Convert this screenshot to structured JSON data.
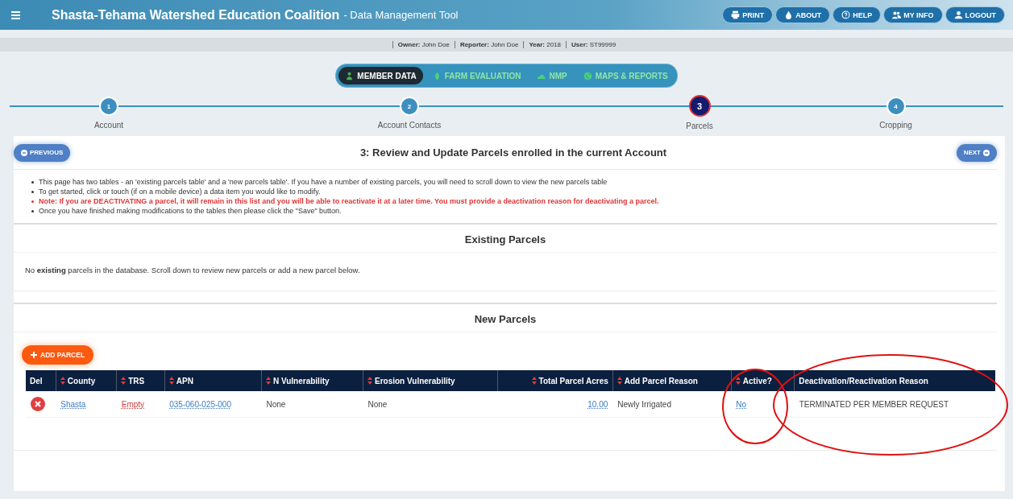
{
  "header": {
    "title": "Shasta-Tehama Watershed Education Coalition",
    "subtitle": "- Data Management Tool",
    "buttons": [
      {
        "label": "PRINT",
        "kind": "print"
      },
      {
        "label": "ABOUT",
        "kind": "about"
      },
      {
        "label": "HELP",
        "kind": "help"
      },
      {
        "label": "MY INFO",
        "kind": "users"
      },
      {
        "label": "LOGOUT",
        "kind": "user"
      }
    ]
  },
  "info_bar": [
    {
      "label": "Owner:",
      "value": "John Doe"
    },
    {
      "label": "Reporter:",
      "value": "John Doe"
    },
    {
      "label": "Year:",
      "value": "2018"
    },
    {
      "label": "User:",
      "value": "ST99999"
    }
  ],
  "modules": [
    {
      "label": "MEMBER DATA",
      "kind": "person",
      "selected": true
    },
    {
      "label": "FARM EVALUATION",
      "kind": "leaf",
      "selected": false
    },
    {
      "label": "NMP",
      "kind": "cloud",
      "selected": false
    },
    {
      "label": "MAPS & REPORTS",
      "kind": "globe",
      "selected": false
    }
  ],
  "steps": [
    {
      "number": "1",
      "label": "Account",
      "selected": false
    },
    {
      "number": "2",
      "label": "Account Contacts",
      "selected": false
    },
    {
      "number": "3",
      "label": "Parcels",
      "selected": true
    },
    {
      "number": "4",
      "label": "Cropping",
      "selected": false
    }
  ],
  "page": {
    "previous": "PREVIOUS",
    "title": "3: Review and Update Parcels enrolled in the current Account",
    "next": "NEXT",
    "notes": [
      {
        "kind": "info",
        "text": "This page has two tables - an 'existing parcels table' and a 'new parcels table'. If you have a number of existing parcels, you will need to scroll down to view the new parcels table"
      },
      {
        "kind": "info",
        "text": "To get started, click or touch (if on a mobile device) a data item you would like to modify."
      },
      {
        "kind": "warning",
        "text": "Note: If you are DEACTIVATING a parcel, it will remain in this list and you will be able to reactivate it at a later time. You must provide a deactivation reason for deactivating a parcel."
      },
      {
        "kind": "info",
        "text": "Once you have finished making modifications to the tables then please click the \"Save\" button."
      }
    ]
  },
  "existing_parcels": {
    "heading": "Existing Parcels",
    "message": "No **existing** parcels in the database. Scroll down to review new parcels or add a new parcel below."
  },
  "new_parcels": {
    "heading": "New Parcels",
    "add_button": "ADD PARCEL",
    "table": {
      "columns": [
        {
          "label": "Del",
          "sortable": false,
          "kind": "text"
        },
        {
          "label": "County",
          "sortable": true,
          "kind": "text"
        },
        {
          "label": "TRS",
          "sortable": true,
          "kind": "text"
        },
        {
          "label": "APN",
          "sortable": true,
          "kind": "text"
        },
        {
          "label": "N Vulnerability",
          "sortable": true,
          "kind": "text"
        },
        {
          "label": "Erosion Vulnerability",
          "sortable": true,
          "kind": "text"
        },
        {
          "label": "Total Parcel Acres",
          "sortable": true,
          "kind": "numeric"
        },
        {
          "label": "Add Parcel Reason",
          "sortable": true,
          "kind": "text"
        },
        {
          "label": "Active?",
          "sortable": true,
          "kind": "text"
        },
        {
          "label": "Deactivation/Reactivation Reason",
          "sortable": false,
          "kind": "text"
        }
      ],
      "rows": [
        [
          {
            "kind": "delete"
          },
          {
            "kind": "link",
            "text": "Shasta"
          },
          {
            "kind": "empty",
            "text": "Empty"
          },
          {
            "kind": "link",
            "text": "035-060-025-000"
          },
          {
            "kind": "text",
            "text": "None"
          },
          {
            "kind": "text",
            "text": "None"
          },
          {
            "kind": "link",
            "text": "10.00"
          },
          {
            "kind": "text",
            "text": "Newly Irrigated"
          },
          {
            "kind": "link",
            "text": "No"
          },
          {
            "kind": "text",
            "text": "TERMINATED PER MEMBER REQUEST"
          }
        ]
      ]
    }
  }
}
